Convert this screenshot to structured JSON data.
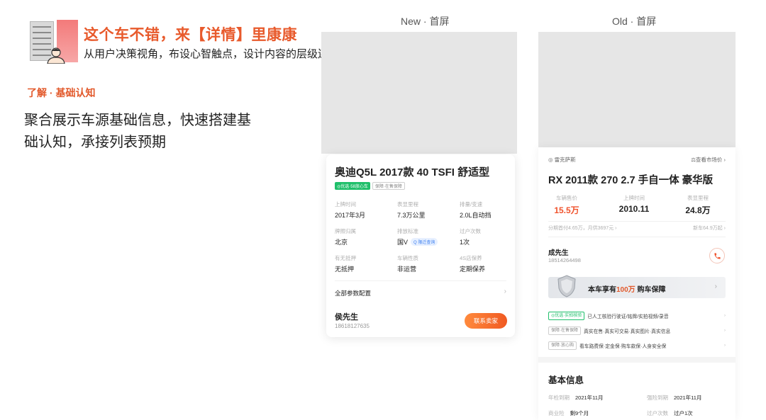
{
  "header": {
    "title": "这个车不错，来【详情】里康康",
    "subtitle": "从用户决策视角，布设心智触点，设计内容的层级连贯性"
  },
  "section": {
    "tag": "了解 · 基础认知",
    "description": "聚合展示车源基础信息，快速搭建基础认知，承接列表预期"
  },
  "columns": {
    "new_label": "New · 首屏",
    "old_label": "Old · 首屏"
  },
  "new_screen": {
    "car_title": "奥迪Q5L 2017款 40 TSFI 舒适型",
    "badge_primary": "◎优选·58放心车",
    "badge_secondary": "保障·在售保障",
    "specs": [
      {
        "label": "上牌时间",
        "value": "2017年3月"
      },
      {
        "label": "表显里程",
        "value": "7.3万公里"
      },
      {
        "label": "排量/变速",
        "value": "2.0L自动挡"
      },
      {
        "label": "牌照归属",
        "value": "北京"
      },
      {
        "label": "排放标准",
        "value": "国V",
        "pill": "Q 限迁查询"
      },
      {
        "label": "过户次数",
        "value": "1次"
      },
      {
        "label": "有无抵押",
        "value": "无抵押"
      },
      {
        "label": "车辆性质",
        "value": "非运营"
      },
      {
        "label": "4S店保养",
        "value": "定期保养"
      }
    ],
    "params_label": "全部参数配置",
    "params_chevron": "›",
    "seller_name": "侯先生",
    "seller_phone": "18618127635",
    "contact_button": "联系卖家"
  },
  "old_screen": {
    "brand": "◎ 雷克萨斯",
    "market_link": "⚖查看市场价 ›",
    "car_title": "RX 2011款 270 2.7 手自一体 豪华版",
    "stats": [
      {
        "label": "车辆售价",
        "value": "15.5万"
      },
      {
        "label": "上牌时间",
        "value": "2010.11"
      },
      {
        "label": "表显里程",
        "value": "24.8万"
      }
    ],
    "monthly": "分期首付4.65万，月供3697元 ›",
    "new_car_price": "新车64.9万起 ›",
    "seller_name": "成先生",
    "seller_phone": "18514264498",
    "banner_prefix": "本车享有",
    "banner_highlight": "100万",
    "banner_suffix": " 购车保障",
    "banner_chevron": "›",
    "tag_rows": [
      {
        "tag": "◎优选·实拍核验",
        "text": "已人工核验行驶证/铭牌/实拍视频/录音",
        "chev": "›"
      },
      {
        "tag": "保障·在售保障",
        "text": "真实在售·真实可交易·真实图片·真实信息",
        "chev": "›"
      },
      {
        "tag": "保障·放心购",
        "text": "看车路费保·定金保·购车款保·人身安全保",
        "chev": "›"
      }
    ],
    "info_title": "基本信息",
    "info_rows": [
      {
        "k": "年检到期",
        "v": "2021年11月"
      },
      {
        "k": "强险到期",
        "v": "2021年11月"
      },
      {
        "k": "商业险",
        "v": "剩9个月"
      },
      {
        "k": "过户次数",
        "v": "过户1次"
      }
    ]
  },
  "colors": {
    "accent_orange": "#e85a2c",
    "price_red": "#f0532d",
    "green_badge": "#1fbf6a"
  }
}
